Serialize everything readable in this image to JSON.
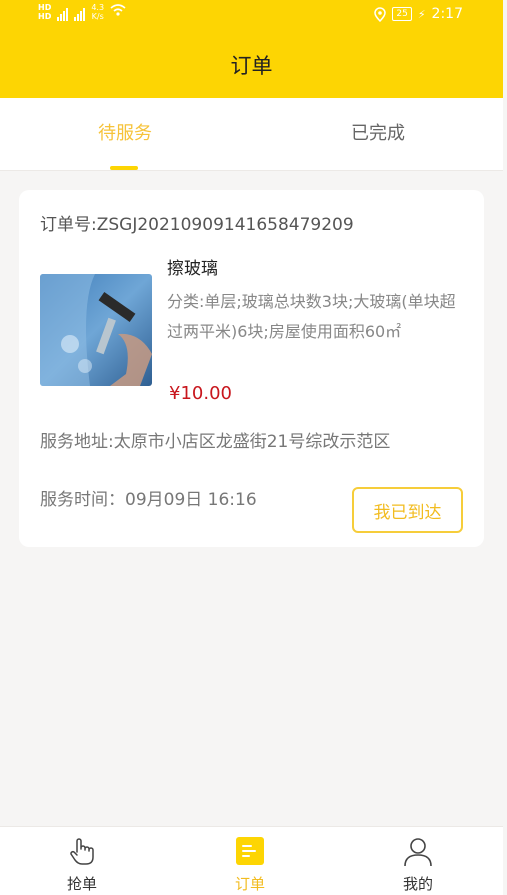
{
  "status_bar": {
    "hd1": "HD",
    "hd2": "HD",
    "net_speed": "4.3",
    "net_unit": "K/s",
    "battery": "25",
    "time": "2:17"
  },
  "header": {
    "title": "订单"
  },
  "tabs": [
    {
      "label": "待服务",
      "active": true
    },
    {
      "label": "已完成",
      "active": false
    }
  ],
  "order": {
    "order_no": "订单号:ZSGJ20210909141658479209",
    "service_name": "擦玻璃",
    "description": "分类:单层;玻璃总块数3块;大玻璃(单块超过两平米)6块;房屋使用面积60㎡",
    "price": "¥10.00",
    "address": "服务地址:太原市小店区龙盛街21号综改示范区",
    "time": "服务时间：09月09日 16:16",
    "action_label": "我已到达"
  },
  "bottom_nav": [
    {
      "label": "抢单",
      "icon": "hand-pointer-icon",
      "active": false
    },
    {
      "label": "订单",
      "icon": "order-list-icon",
      "active": true
    },
    {
      "label": "我的",
      "icon": "user-icon",
      "active": false
    }
  ],
  "colors": {
    "brand_yellow": "#fdd503",
    "accent_text": "#f2bc20",
    "price_red": "#c8161d"
  }
}
